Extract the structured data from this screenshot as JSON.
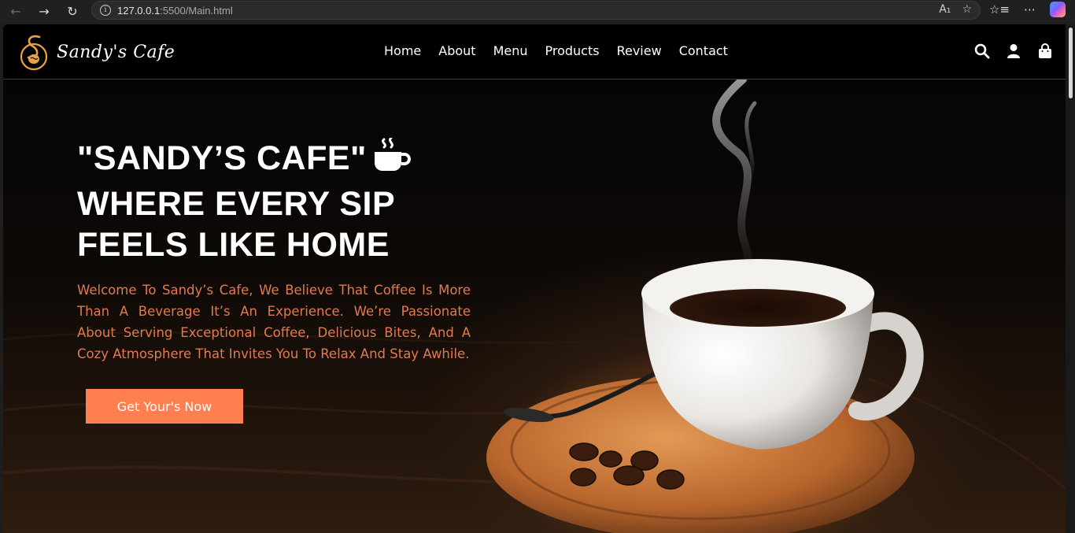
{
  "browser": {
    "url_host": "127.0.0.1",
    "url_rest": ":5500/Main.html"
  },
  "header": {
    "logo_text": "Sandy's Cafe",
    "nav": [
      {
        "label": "Home"
      },
      {
        "label": "About"
      },
      {
        "label": "Menu"
      },
      {
        "label": "Products"
      },
      {
        "label": "Review"
      },
      {
        "label": "Contact"
      }
    ],
    "icons": [
      "search-icon",
      "user-icon",
      "shopping-bag-icon"
    ]
  },
  "hero": {
    "title_line1": "\"SANDY’S CAFE\"",
    "title_line2": "WHERE EVERY SIP",
    "title_line3": "FEELS LIKE HOME",
    "description": "Welcome To Sandy’s Cafe, We Believe That Coffee Is More Than A Beverage It’s An Experience. We’re Passionate About Serving Exceptional Coffee, Delicious Bites, And A Cozy Atmosphere That Invites You To Relax And Stay Awhile.",
    "cta_label": "Get Your's Now"
  },
  "colors": {
    "accent": "#ff7f50",
    "description_text": "#e07a50",
    "logo_gold": "#e8a24a"
  }
}
